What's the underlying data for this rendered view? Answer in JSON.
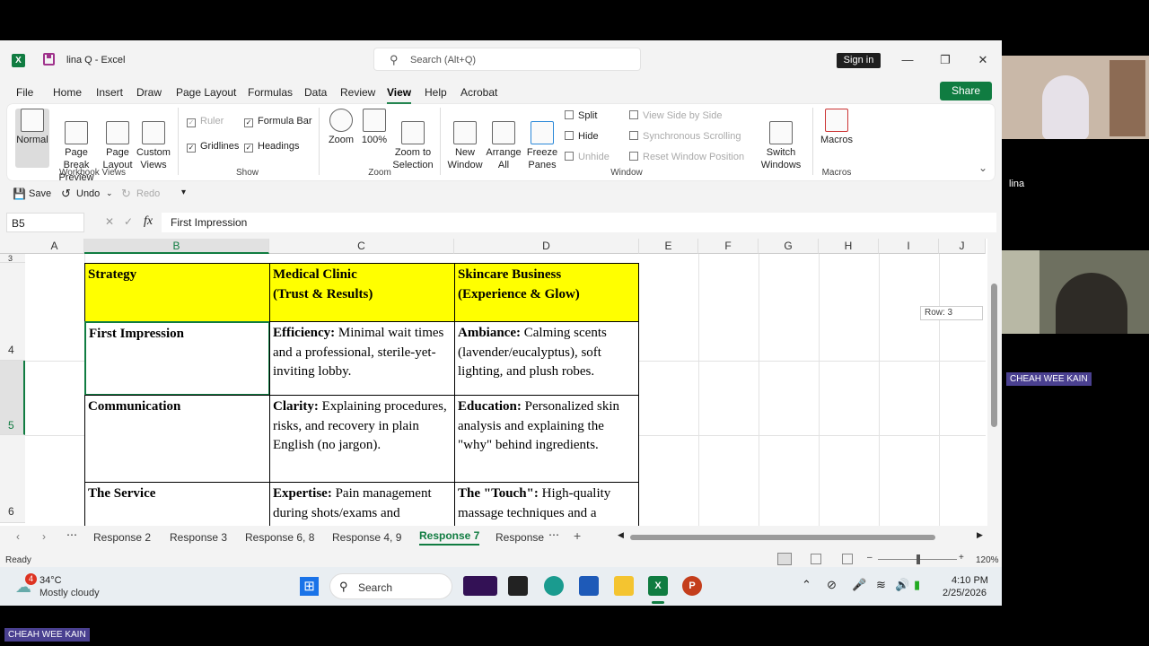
{
  "window": {
    "title": "lina Q  -  Excel",
    "search_placeholder": "Search (Alt+Q)",
    "sign_in": "Sign in",
    "share": "Share"
  },
  "menu": [
    "File",
    "Home",
    "Insert",
    "Draw",
    "Page Layout",
    "Formulas",
    "Data",
    "Review",
    "View",
    "Help",
    "Acrobat"
  ],
  "ribbon": {
    "workbook_views": {
      "label": "Workbook Views",
      "normal": "Normal",
      "page_break": "Page Break\nPreview",
      "page_layout": "Page\nLayout",
      "custom": "Custom\nViews"
    },
    "show": {
      "label": "Show",
      "ruler": "Ruler",
      "formula_bar": "Formula Bar",
      "gridlines": "Gridlines",
      "headings": "Headings"
    },
    "zoom": {
      "label": "Zoom",
      "zoom": "Zoom",
      "hundred": "100%",
      "zoom_sel": "Zoom to\nSelection"
    },
    "window": {
      "label": "Window",
      "new_window": "New\nWindow",
      "arrange": "Arrange\nAll",
      "freeze": "Freeze\nPanes",
      "split": "Split",
      "hide": "Hide",
      "unhide": "Unhide",
      "side_by_side": "View Side by Side",
      "sync": "Synchronous Scrolling",
      "reset": "Reset Window Position",
      "switch": "Switch\nWindows"
    },
    "macros": {
      "label": "Macros",
      "macros": "Macros"
    }
  },
  "qat": {
    "save": "Save",
    "undo": "Undo",
    "redo": "Redo"
  },
  "formula": {
    "namebox": "B5",
    "content": "First Impression",
    "fx": "fx"
  },
  "columns": [
    "A",
    "B",
    "C",
    "D",
    "E",
    "F",
    "G",
    "H",
    "I",
    "J"
  ],
  "rows": [
    "3",
    "4",
    "5",
    "6"
  ],
  "table": {
    "header": [
      "Strategy",
      "Medical Clinic\n(Trust & Results)",
      "Skincare Business\n(Experience & Glow)"
    ],
    "r5": {
      "b": "First Impression",
      "c_bold": "Efficiency:",
      "c": " Minimal wait times and a professional, sterile-yet-inviting lobby.",
      "d_bold": "Ambiance:",
      "d": " Calming scents (lavender/eucalyptus), soft lighting, and plush robes."
    },
    "r6": {
      "b": "Communication",
      "c_bold": "Clarity:",
      "c": " Explaining procedures, risks, and recovery in plain English (no jargon).",
      "d_bold": "Education:",
      "d": " Personalized skin analysis and explaining the \"why\" behind ingredients."
    },
    "r7": {
      "b": "The Service",
      "c_bold": "Expertise:",
      "c": " Pain management during shots/exams and",
      "d_bold": "The \"Touch\":",
      "d": " High-quality massage techniques and a"
    }
  },
  "row_tooltip": "Row: 3",
  "tabs": [
    "Response 2",
    "Response 3",
    "Response 6, 8",
    "Response 4, 9",
    "Response 7",
    "Response"
  ],
  "status": {
    "ready": "Ready",
    "zoom": "120%"
  },
  "taskbar": {
    "temp": "34°C",
    "weather": "Mostly cloudy",
    "badge": "4",
    "search": "Search",
    "time": "4:10 PM",
    "date": "2/25/2026"
  },
  "participants": {
    "p1": "lina",
    "p2": "CHEAH WEE KAIN",
    "bottom": "CHEAH WEE KAIN"
  }
}
